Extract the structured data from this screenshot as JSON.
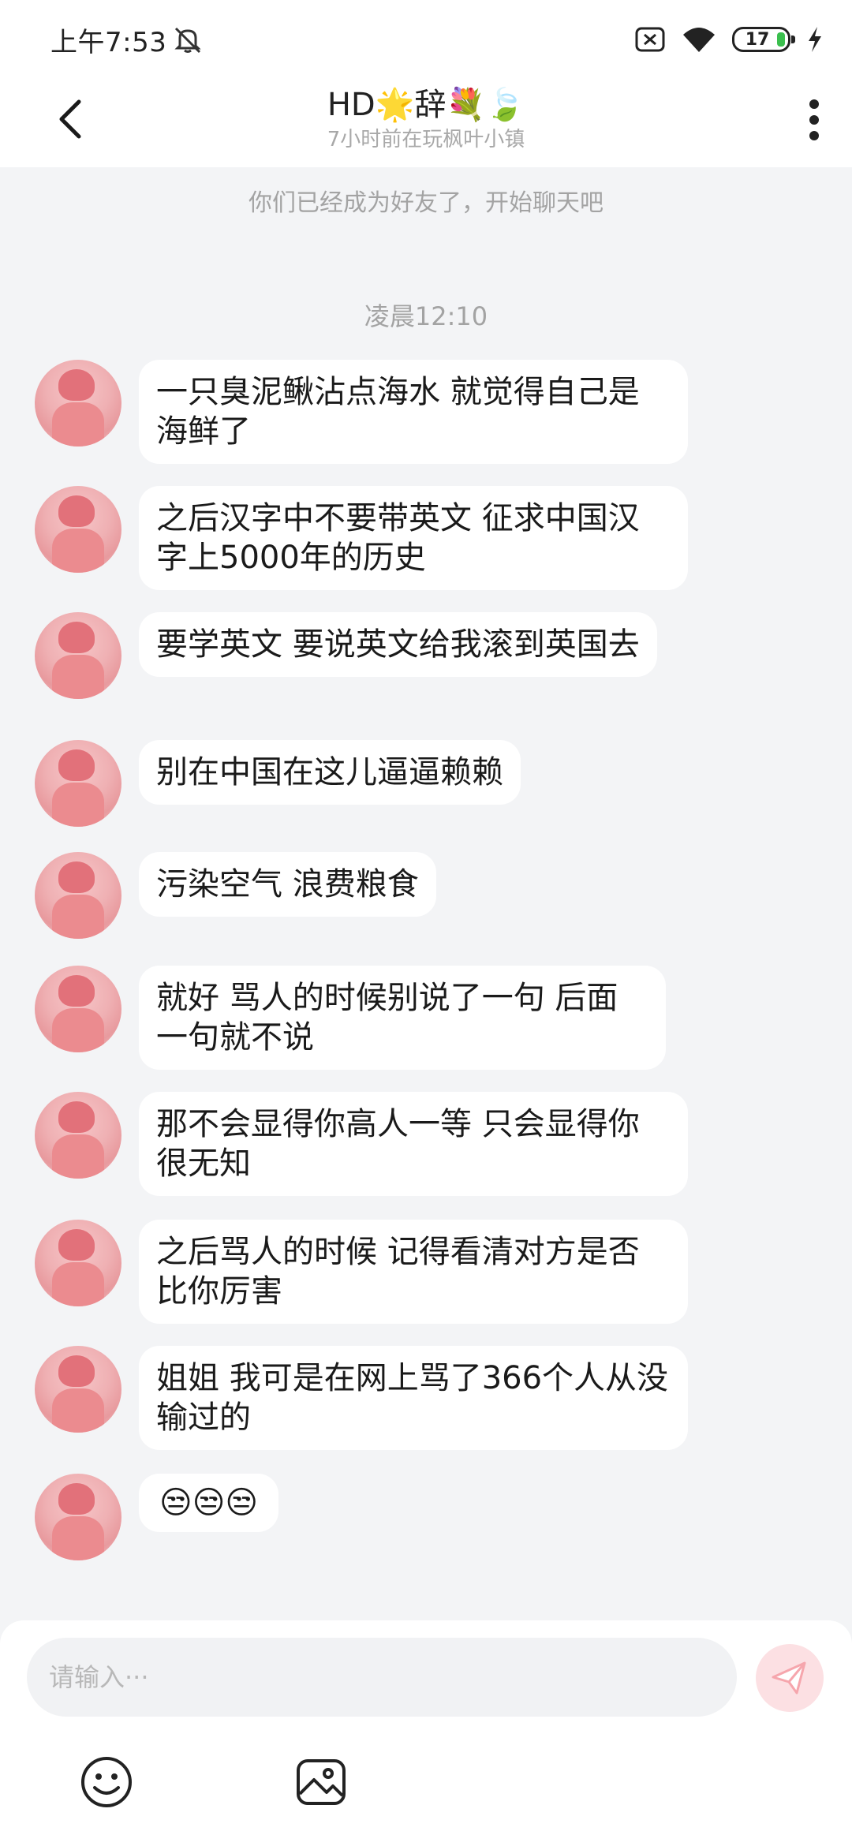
{
  "status_bar": {
    "time": "上午7:53",
    "battery": "17"
  },
  "header": {
    "title": "HD🌟辞💐🍃",
    "subtitle": "7小时前在玩枫叶小镇"
  },
  "chat": {
    "system_note": "你们已经成为好友了，开始聊天吧",
    "timestamp": "凌晨12:10",
    "messages": [
      {
        "text": "一只臭泥鳅沾点海水 就觉得自己是海鲜了"
      },
      {
        "text": "之后汉字中不要带英文 征求中国汉字上5000年的历史"
      },
      {
        "text": "要学英文 要说英文给我滚到英国去"
      },
      {
        "text": "别在中国在这儿逼逼赖赖"
      },
      {
        "text": "污染空气 浪费粮食"
      },
      {
        "text": "就好 骂人的时候别说了一句 后面一句就不说"
      },
      {
        "text": "那不会显得你高人一等 只会显得你很无知"
      },
      {
        "text": "之后骂人的时候 记得看清对方是否比你厉害"
      },
      {
        "text": "姐姐 我可是在网上骂了366个人从没输过的"
      },
      {
        "text": "😒😒😒"
      }
    ]
  },
  "composer": {
    "placeholder": "请输入···"
  },
  "colors": {
    "background": "#f3f4f6",
    "bubble": "#ffffff",
    "send_button": "#fce0e3",
    "send_icon": "#f6a6ad"
  }
}
